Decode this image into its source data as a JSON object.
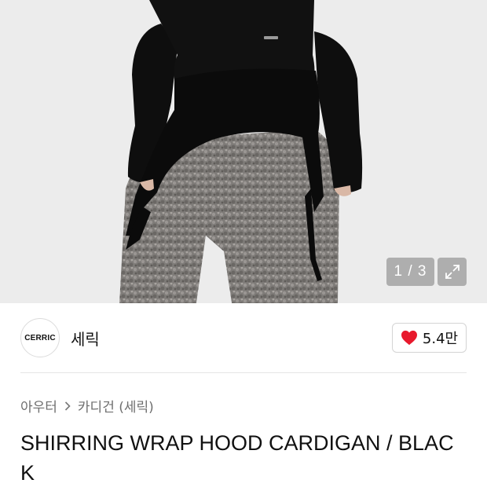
{
  "gallery": {
    "current_page": 1,
    "total_pages": 3,
    "pager_text": "1 / 3",
    "expand_icon": "expand-arrows-icon",
    "photo_description_colors": {
      "background": "#ececec",
      "garment": "#0d0d0d",
      "pants": "#7d7a77"
    }
  },
  "brand": {
    "logo_text": "CERRIC",
    "name": "세릭"
  },
  "like": {
    "icon": "heart-icon",
    "icon_color": "#e8192c",
    "count": "5.4만"
  },
  "breadcrumb": {
    "items": [
      "아우터",
      "카디건 (세릭)"
    ],
    "separator_icon": "chevron-right-icon"
  },
  "product": {
    "title": "SHIRRING WRAP HOOD CARDIGAN / BLACK"
  }
}
